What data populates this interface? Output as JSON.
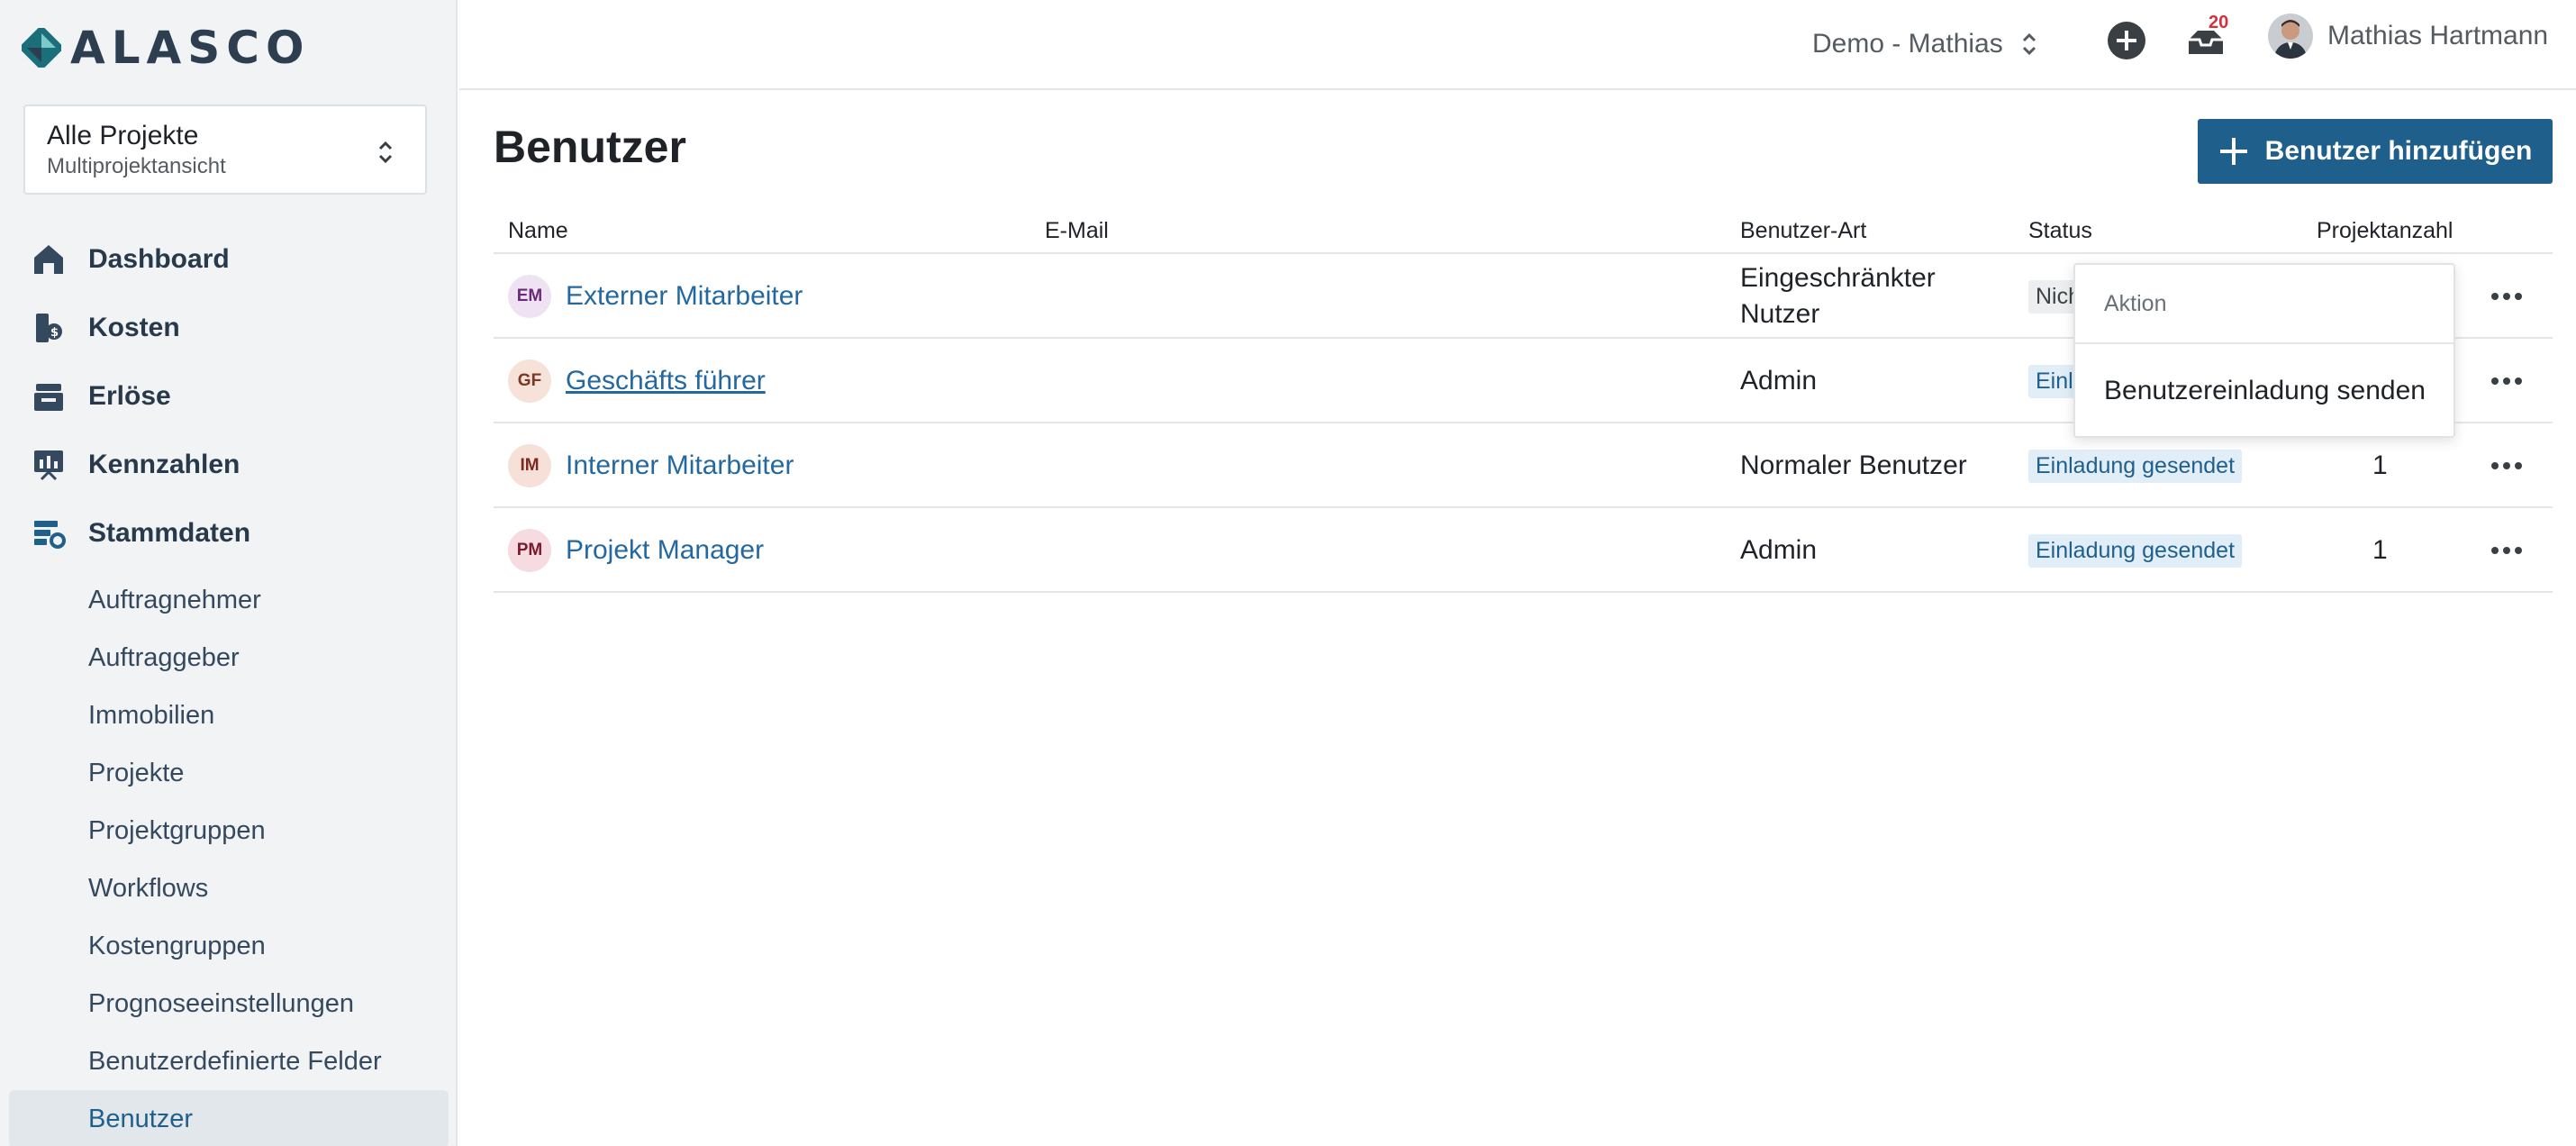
{
  "brand": {
    "name": "ALASCO"
  },
  "project_selector": {
    "title": "Alle Projekte",
    "subtitle": "Multiprojektansicht"
  },
  "nav": {
    "items": [
      {
        "label": "Dashboard",
        "icon": "home-icon"
      },
      {
        "label": "Kosten",
        "icon": "costs-icon"
      },
      {
        "label": "Erlöse",
        "icon": "revenue-icon"
      },
      {
        "label": "Kennzahlen",
        "icon": "chart-icon"
      },
      {
        "label": "Stammdaten",
        "icon": "master-data-icon"
      }
    ],
    "sub_items": [
      "Auftragnehmer",
      "Auftraggeber",
      "Immobilien",
      "Projekte",
      "Projektgruppen",
      "Workflows",
      "Kostengruppen",
      "Prognoseeinstellungen",
      "Benutzerdefinierte Felder",
      "Benutzer"
    ],
    "active_sub": "Benutzer"
  },
  "topbar": {
    "org": "Demo - Mathias",
    "notification_count": "20",
    "user_name": "Mathias Hartmann"
  },
  "page": {
    "title": "Benutzer",
    "add_button": "Benutzer hinzufügen"
  },
  "table": {
    "headers": {
      "name": "Name",
      "email": "E-Mail",
      "type": "Benutzer-Art",
      "status": "Status",
      "projects": "Projektanzahl"
    },
    "rows": [
      {
        "initials": "EM",
        "name": "Externer Mitarbeiter",
        "email": "",
        "type_line1": "Eingeschränkter",
        "type_line2": "Nutzer",
        "status": "Nicht eingeladen",
        "projects": "",
        "avatar_bg": "#efe3f3",
        "avatar_fg": "#6a2a7a"
      },
      {
        "initials": "GF",
        "name": "Geschäfts führer",
        "email": "",
        "type_line1": "Admin",
        "type_line2": "",
        "status": "Einladung gesendet",
        "projects": "",
        "avatar_bg": "#f6e2d8",
        "avatar_fg": "#7a3a22"
      },
      {
        "initials": "IM",
        "name": "Interner Mitarbeiter",
        "email": "",
        "type_line1": "Normaler Benutzer",
        "type_line2": "",
        "status": "Einladung gesendet",
        "projects": "1",
        "avatar_bg": "#f6e0d8",
        "avatar_fg": "#7a2a22"
      },
      {
        "initials": "PM",
        "name": "Projekt Manager",
        "email": "",
        "type_line1": "Admin",
        "type_line2": "",
        "status": "Einladung gesendet",
        "projects": "1",
        "avatar_bg": "#f6dbe0",
        "avatar_fg": "#7a1a2a"
      }
    ]
  },
  "dropdown": {
    "header": "Aktion",
    "item": "Benutzereinladung senden"
  },
  "colors": {
    "primary": "#1f5f8b",
    "link": "#2468a0",
    "badge": "#d8303a",
    "sidebar_bg": "#f1f3f5"
  }
}
